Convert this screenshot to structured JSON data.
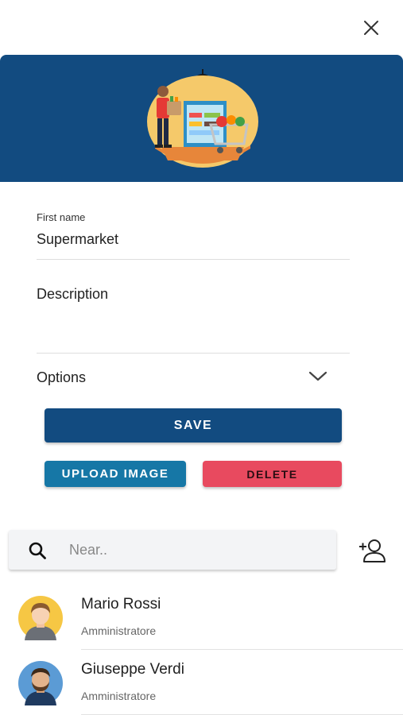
{
  "form": {
    "first_name_label": "First name",
    "first_name_value": "Supermarket",
    "description_label": "Description",
    "options_label": "Options"
  },
  "buttons": {
    "save": "SAVE",
    "upload_image": "UPLOAD IMAGE",
    "delete": "DELETE"
  },
  "search": {
    "placeholder": "Near.."
  },
  "members": [
    {
      "name": "Mario Rossi",
      "role": "Amministratore"
    },
    {
      "name": "Giuseppe Verdi",
      "role": "Amministratore"
    }
  ],
  "colors": {
    "primary": "#124b80",
    "upload": "#1677a6",
    "delete": "#e84a5f"
  }
}
